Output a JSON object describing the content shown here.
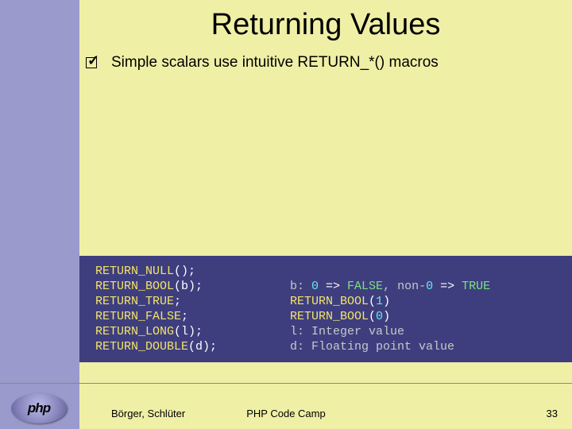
{
  "title": "Returning Values",
  "bullet": "Simple scalars use intuitive RETURN_*() macros",
  "code": {
    "rows": [
      {
        "left": [
          {
            "t": "RETURN_NULL",
            "c": "kw-yellow"
          },
          {
            "t": "();",
            "c": ""
          }
        ],
        "right": []
      },
      {
        "left": [
          {
            "t": "RETURN_BOOL",
            "c": "kw-yellow"
          },
          {
            "t": "(b);",
            "c": ""
          }
        ],
        "right": [
          {
            "t": "b: ",
            "c": "comment"
          },
          {
            "t": "0",
            "c": "kw-cyan"
          },
          {
            "t": " => ",
            "c": ""
          },
          {
            "t": "FALSE",
            "c": "kw-green"
          },
          {
            "t": ", non-",
            "c": "comment"
          },
          {
            "t": "0",
            "c": "kw-cyan"
          },
          {
            "t": " => ",
            "c": ""
          },
          {
            "t": "TRUE",
            "c": "kw-green"
          }
        ]
      },
      {
        "left": [
          {
            "t": "RETURN_TRUE",
            "c": "kw-yellow"
          },
          {
            "t": ";",
            "c": ""
          }
        ],
        "right": [
          {
            "t": "RETURN_BOOL",
            "c": "kw-yellow"
          },
          {
            "t": "(",
            "c": ""
          },
          {
            "t": "1",
            "c": "kw-cyan"
          },
          {
            "t": ")",
            "c": ""
          }
        ]
      },
      {
        "left": [
          {
            "t": "RETURN_FALSE",
            "c": "kw-yellow"
          },
          {
            "t": ";",
            "c": ""
          }
        ],
        "right": [
          {
            "t": "RETURN_BOOL",
            "c": "kw-yellow"
          },
          {
            "t": "(",
            "c": ""
          },
          {
            "t": "0",
            "c": "kw-cyan"
          },
          {
            "t": ")",
            "c": ""
          }
        ]
      },
      {
        "left": [
          {
            "t": "RETURN_LONG",
            "c": "kw-yellow"
          },
          {
            "t": "(l);",
            "c": ""
          }
        ],
        "right": [
          {
            "t": "l: Integer value",
            "c": "comment"
          }
        ]
      },
      {
        "left": [
          {
            "t": "RETURN_DOUBLE",
            "c": "kw-yellow"
          },
          {
            "t": "(d);",
            "c": ""
          }
        ],
        "right": [
          {
            "t": "d: Floating point value",
            "c": "comment"
          }
        ]
      }
    ]
  },
  "footer": {
    "author": "Börger, Schlüter",
    "center": "PHP Code Camp",
    "page": "33"
  },
  "logo": {
    "text": "php"
  }
}
